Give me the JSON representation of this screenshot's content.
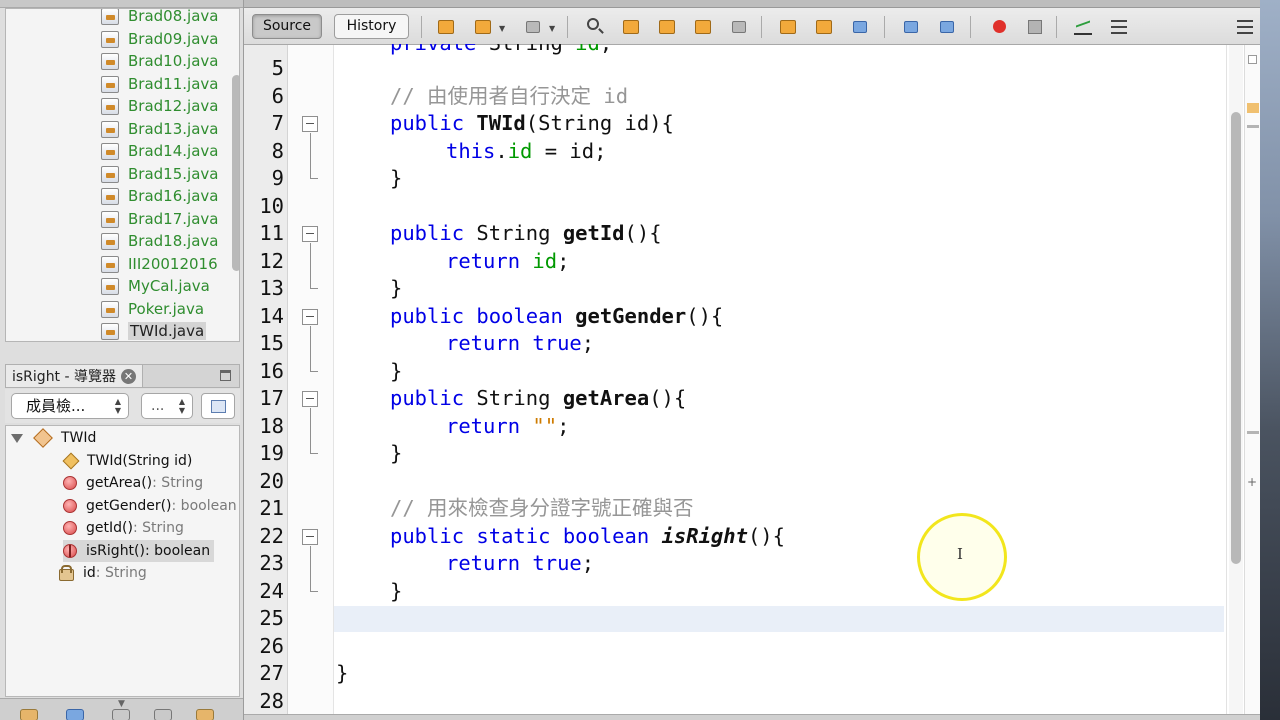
{
  "project": {
    "files": [
      {
        "label": "Brad08.java"
      },
      {
        "label": "Brad09.java"
      },
      {
        "label": "Brad10.java"
      },
      {
        "label": "Brad11.java"
      },
      {
        "label": "Brad12.java"
      },
      {
        "label": "Brad13.java"
      },
      {
        "label": "Brad14.java"
      },
      {
        "label": "Brad15.java"
      },
      {
        "label": "Brad16.java"
      },
      {
        "label": "Brad17.java"
      },
      {
        "label": "Brad18.java"
      },
      {
        "label": "III20012016"
      },
      {
        "label": "MyCal.java"
      },
      {
        "label": "Poker.java"
      },
      {
        "label": "TWId.java"
      }
    ],
    "selected_index": 14
  },
  "navigator": {
    "tab_title": "isRight - 導覽器",
    "member_select": "成員檢...",
    "filter_select": "...",
    "class_name": "TWId",
    "members": [
      {
        "name": "TWId(String id)",
        "type": "",
        "kind": "constructor"
      },
      {
        "name": "getArea()",
        "type": " : String",
        "kind": "method"
      },
      {
        "name": "getGender()",
        "type": " : boolean",
        "kind": "method"
      },
      {
        "name": "getId()",
        "type": " : String",
        "kind": "method"
      },
      {
        "name": "isRight()",
        "type": " : boolean",
        "kind": "static-method"
      },
      {
        "name": "id",
        "type": " : String",
        "kind": "field"
      }
    ]
  },
  "editor": {
    "source_tab": "Source",
    "history_tab": "History",
    "line_numbers": [
      "5",
      "6",
      "7",
      "8",
      "9",
      "10",
      "11",
      "12",
      "13",
      "14",
      "15",
      "16",
      "17",
      "18",
      "19",
      "20",
      "21",
      "22",
      "23",
      "24",
      "25",
      "26",
      "27",
      "28"
    ],
    "partial_top_line": {
      "kw": "private",
      "type": "String",
      "field": "id",
      "end": ";"
    },
    "comment_1": "// 由使用者自行決定 id",
    "comment_2": "// 用來檢查身分證字號正確與否",
    "kw_public": "public",
    "kw_static": "static",
    "kw_boolean": "boolean",
    "kw_this": "this",
    "kw_return": "return",
    "kw_true": "true",
    "type_string": "String",
    "ctor_name": "TWId",
    "ctor_params": "(String id){",
    "field_id": "id",
    "assign_rest": " = id;",
    "get_id": "getId",
    "get_gender": "getGender",
    "get_area": "getArea",
    "is_right": "isRight",
    "empty_parens": "(){",
    "semicolon": ";",
    "dot": ".",
    "empty_string": "\"\"",
    "close_brace": "}"
  },
  "colors": {
    "keyword": "#0000e6",
    "field": "#009900",
    "comment": "#969696",
    "string": "#ce7b00",
    "project_file": "#2f8d2f",
    "cursor_highlight": "#f2e61c"
  }
}
